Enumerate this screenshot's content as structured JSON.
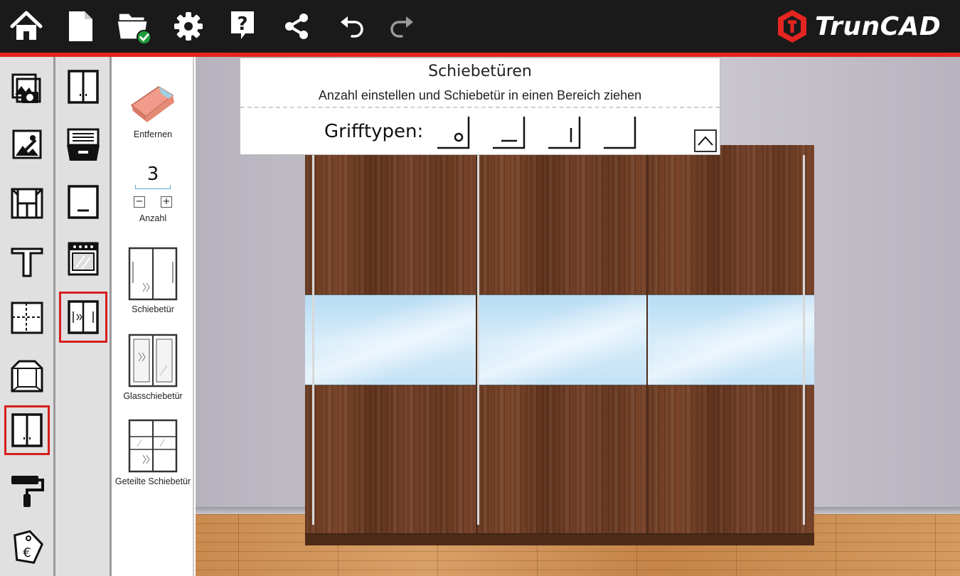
{
  "app": {
    "logo_text": "TrunCAD"
  },
  "toolbar": {
    "items": [
      "home-icon",
      "new-file-icon",
      "open-folder-icon",
      "settings-icon",
      "help-icon",
      "share-icon",
      "undo-icon",
      "redo-icon"
    ]
  },
  "colors": {
    "accent": "#e52521",
    "toolbar_bg": "#1a1a1a",
    "selected_border": "#d71e1e",
    "check_green": "#1f9c3a"
  },
  "sidebar_primary": {
    "items": [
      "gallery-camera-icon",
      "image-edit-icon",
      "cabinet-interior-icon",
      "table-icon",
      "partition-icon",
      "box-3d-icon",
      "double-door-icon",
      "paint-roller-icon",
      "price-tag-icon"
    ],
    "selected_index": 6
  },
  "sidebar_secondary": {
    "items": [
      "hinged-door-icon",
      "drawer-icon",
      "flap-icon",
      "oven-icon",
      "sliding-door-icon"
    ],
    "selected_index": 4
  },
  "tools": {
    "remove_label": "Entfernen",
    "count_value": "3",
    "count_minus": "−",
    "count_plus": "+",
    "count_label": "Anzahl",
    "sliding_door_label": "Schiebetür",
    "glass_sliding_door_label": "Glasschiebetür",
    "divided_sliding_door_label": "Geteilte Schiebetür"
  },
  "panel": {
    "title": "Schiebetüren",
    "subtitle": "Anzahl einstellen und Schiebetür in einen Bereich ziehen",
    "grip_label": "Grifftypen:",
    "grip_types": [
      "knob-grip-icon",
      "bar-bottom-grip-icon",
      "bar-vertical-grip-icon",
      "no-grip-icon"
    ]
  },
  "scene": {
    "door_count": 3
  }
}
